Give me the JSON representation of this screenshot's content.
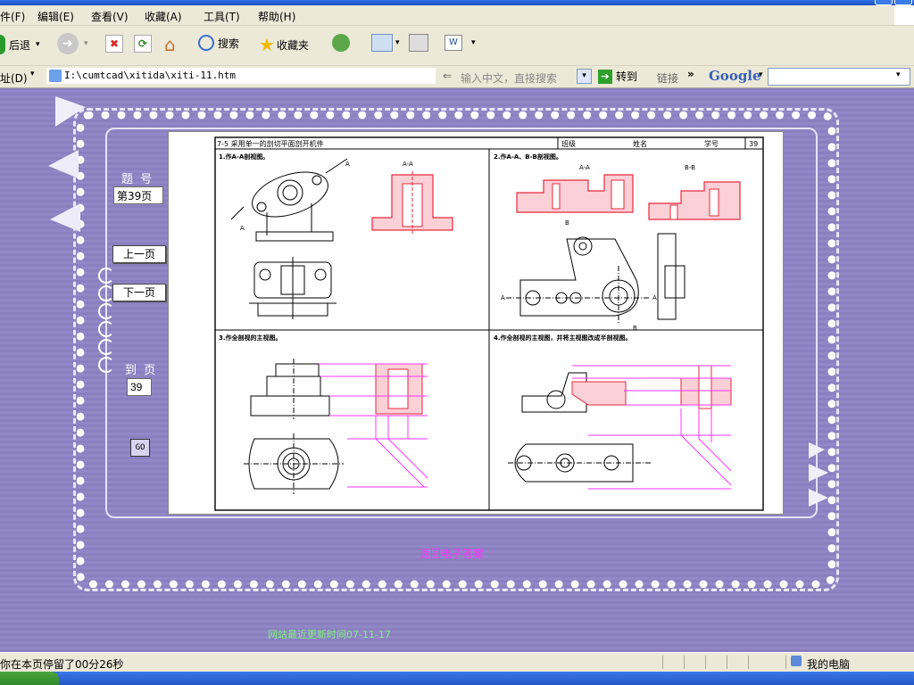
{
  "menu": [
    "件(F)",
    "编辑(E)",
    "查看(V)",
    "收藏(A)",
    "工具(T)",
    "帮助(H)"
  ],
  "toolbar": {
    "back": "后退",
    "search": "搜索",
    "favorites": "收藏夹"
  },
  "address": {
    "label": "址(D)",
    "url": "I:\\cumtcad\\xitida\\xiti-11.htm",
    "search_hint": "输入中文，直接搜索",
    "go": "转到",
    "links": "链接",
    "links_more": "»",
    "google": "Google"
  },
  "nav": {
    "question_label": "题  号",
    "page_value": "第39页",
    "prev": "上一页",
    "next": "下一页",
    "goto_label": "到  页",
    "goto_value": "39",
    "go_icon": "go-button-icon"
  },
  "sheet": {
    "header_title": "7-5  采用单一的剖切平面剖开机件",
    "class_label": "班级",
    "name_label": "姓名",
    "id_label": "学号",
    "page_no": "39",
    "q1": "1.作A-A剖视图。",
    "q2": "2.作A-A、B-B剖视图。",
    "q3": "3.作全剖视的主视图。",
    "q4": "4.作全剖视的主视图，并将主视图改成半剖视图。",
    "aa": "A-A",
    "bb": "B-B",
    "a": "A",
    "b": "B"
  },
  "back_link": "返回电子答案",
  "footer": "网站最近更新时间07-11-17",
  "status": {
    "text": "你在本页停留了00分26秒",
    "zone": "我的电脑"
  },
  "colors": {
    "page_bg": "#8a80c0",
    "section_red": "#e8283c",
    "projection_magenta": "#ff33ff",
    "link": "#ff33ff"
  }
}
